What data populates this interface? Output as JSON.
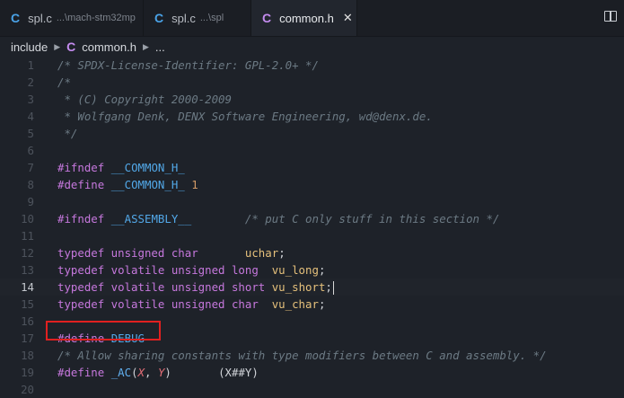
{
  "tabs": [
    {
      "icon": "C",
      "name": "spl.c",
      "desc": "...\\mach-stm32mp"
    },
    {
      "icon": "C",
      "name": "spl.c",
      "desc": "...\\spl"
    },
    {
      "icon": "C",
      "name": "common.h",
      "close": "✕"
    }
  ],
  "breadcrumb": {
    "folder": "include",
    "icon": "C",
    "file": "common.h",
    "more": "..."
  },
  "lines": {
    "n1": "1",
    "n2": "2",
    "n3": "3",
    "n4": "4",
    "n5": "5",
    "n6": "6",
    "n7": "7",
    "n8": "8",
    "n9": "9",
    "n10": "10",
    "n11": "11",
    "n12": "12",
    "n13": "13",
    "n14": "14",
    "n15": "15",
    "n16": "16",
    "n17": "17",
    "n18": "18",
    "n19": "19",
    "n20": "20",
    "l1": "/* SPDX-License-Identifier: GPL-2.0+ */",
    "l2": "/*",
    "l3": " * (C) Copyright 2000-2009",
    "l4": " * Wolfgang Denk, DENX Software Engineering, wd@denx.de.",
    "l5": " */",
    "l7a": "#ifndef ",
    "l7b": "__COMMON_H_",
    "l8a": "#define ",
    "l8b": "__COMMON_H_",
    "l8c": " 1",
    "l10a": "#ifndef ",
    "l10b": "__ASSEMBLY__",
    "l10c": "        /* put C only stuff in this section */",
    "l12a": "typedef unsigned char",
    "l12b": "       uchar",
    "l12c": ";",
    "l13a": "typedef volatile unsigned long",
    "l13b": "  vu_long",
    "l13c": ";",
    "l14a": "typedef volatile unsigned short",
    "l14b": " vu_short",
    "l14c": ";",
    "l15a": "typedef volatile unsigned char",
    "l15b": "  vu_char",
    "l15c": ";",
    "l17a": "#define ",
    "l17b": "DEBUG",
    "l18": "/* Allow sharing constants with type modifiers between C and assembly. */",
    "l19a": "#define ",
    "l19b": "_AC",
    "l19c": "(",
    "l19d": "X",
    "l19e": ", ",
    "l19f": "Y",
    "l19g": ")       (X##Y)"
  },
  "colors": {
    "highlight_box": "#e02020",
    "background": "#1e2229"
  }
}
